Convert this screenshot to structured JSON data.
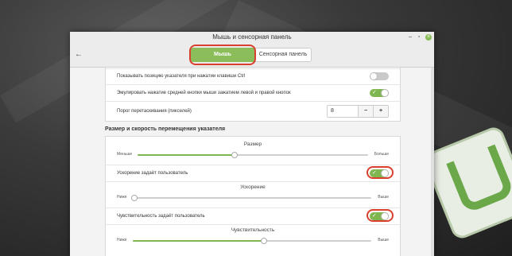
{
  "window": {
    "title": "Мышь и сенсорная панель"
  },
  "tabs": [
    {
      "label": "Мышь",
      "active": true
    },
    {
      "label": "Сенсорная панель",
      "active": false
    }
  ],
  "rows_top": [
    {
      "label": "Показывать позицию указателя при нажатии клавиши Ctrl",
      "checked": false
    },
    {
      "label": "Эмулировать нажатие средней кнопки мыши зажатием левой и правой кнопок",
      "checked": true
    }
  ],
  "drag": {
    "label": "Порог перетаскивания (пикселей)",
    "value": "8",
    "minus": "−",
    "plus": "+"
  },
  "section": {
    "title": "Размер и скорость перемещения указателя"
  },
  "size": {
    "title": "Размер",
    "min": "Меньше",
    "max": "Больше",
    "level": 0.42
  },
  "accel_toggle": {
    "label": "Ускорение задаёт пользователь",
    "checked": true
  },
  "accel": {
    "title": "Ускорение",
    "min": "Ниже",
    "max": "Выше",
    "level": 0.0
  },
  "sens_toggle": {
    "label": "Чувствительность задаёт пользователь",
    "checked": true
  },
  "sens": {
    "title": "Чувствительность",
    "min": "Ниже",
    "max": "Выше",
    "level": 0.55
  },
  "colors": {
    "accent": "#7fb650",
    "highlight": "#d9412e"
  }
}
